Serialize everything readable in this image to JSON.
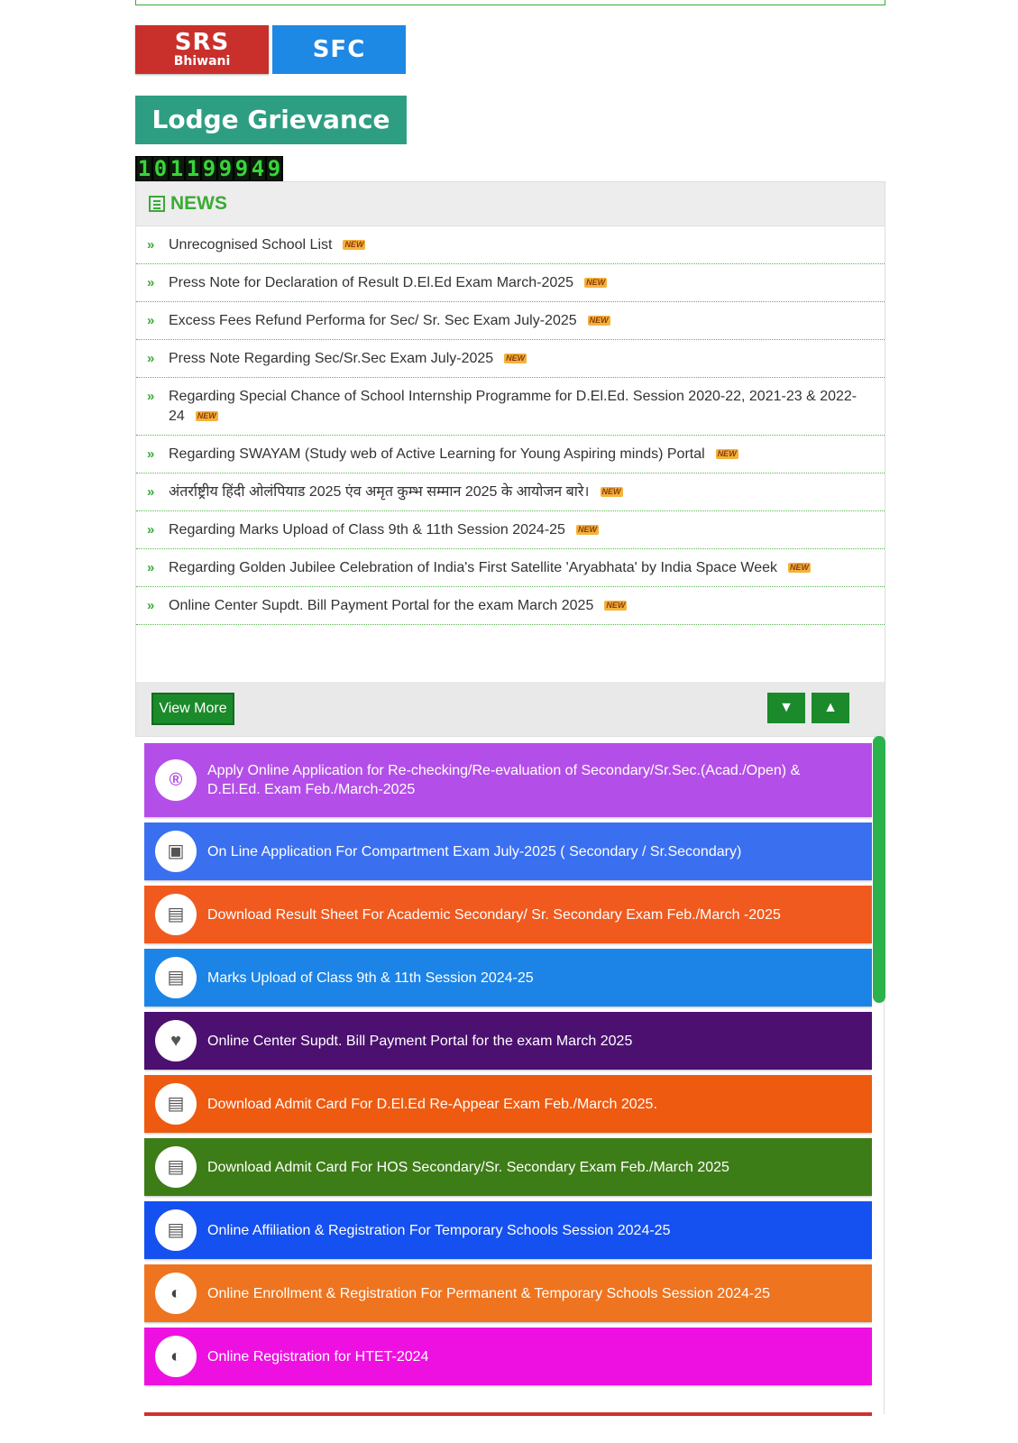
{
  "header": {
    "srs_line1": "SRS",
    "srs_line2": "Bhiwani",
    "sfc_label": "SFC",
    "lodge_label": "Lodge Grievance",
    "counter_digits": [
      "1",
      "0",
      "1",
      "1",
      "9",
      "9",
      "9",
      "4",
      "9"
    ]
  },
  "news": {
    "title": "NEWS",
    "new_badge": "NEW",
    "items": [
      {
        "text": "Unrecognised School List"
      },
      {
        "text": "Press Note for Declaration of Result D.El.Ed Exam March-2025"
      },
      {
        "text": "Excess Fees Refund Performa for Sec/ Sr. Sec Exam July-2025"
      },
      {
        "text": "Press Note Regarding Sec/Sr.Sec Exam July-2025"
      },
      {
        "text": "Regarding Special Chance of School Internship Programme for D.El.Ed. Session 2020-22, 2021-23 & 2022-24"
      },
      {
        "text": "Regarding SWAYAM (Study web of Active Learning for Young Aspiring minds) Portal"
      },
      {
        "text": "अंतर्राष्ट्रीय हिंदी ओलंपियाड 2025 एंव अमृत कुम्भ सम्मान 2025 के आयोजन बारे।"
      },
      {
        "text": "Regarding Marks Upload of Class 9th & 11th Session 2024-25"
      },
      {
        "text": "Regarding Golden Jubilee Celebration of India's First Satellite 'Aryabhata' by India Space Week"
      },
      {
        "text": "Online Center Supdt. Bill Payment Portal for the exam March 2025"
      }
    ],
    "view_more": "View More"
  },
  "services": [
    {
      "label": "Apply Online Application for Re-checking/Re-evaluation of Secondary/Sr.Sec.(Acad./Open) & D.El.Ed. Exam Feb./March-2025",
      "color": "#b44ee8",
      "icon": "registered-icon",
      "glyph": "®",
      "iconColor": "#b44ee8"
    },
    {
      "label": "On Line Application For Compartment Exam July-2025 ( Secondary / Sr.Secondary)",
      "color": "#3a6ff0",
      "icon": "contact-book-icon",
      "glyph": "▣",
      "iconColor": "#555"
    },
    {
      "label": "Download Result Sheet For Academic Secondary/ Sr. Secondary Exam Feb./March -2025",
      "color": "#f05a1e",
      "icon": "id-card-icon",
      "glyph": "▤",
      "iconColor": "#555"
    },
    {
      "label": "Marks Upload of Class 9th & 11th Session 2024-25",
      "color": "#1c84e6",
      "icon": "id-card-icon",
      "glyph": "▤",
      "iconColor": "#555"
    },
    {
      "label": "Online Center Supdt. Bill Payment Portal for the exam March 2025",
      "color": "#4b1070",
      "icon": "heart-circle-icon",
      "glyph": "♥",
      "iconColor": "#555"
    },
    {
      "label": "Download Admit Card For D.El.Ed Re-Appear Exam Feb./March 2025.",
      "color": "#ee5a10",
      "icon": "id-card-outline-icon",
      "glyph": "▤",
      "iconColor": "#555"
    },
    {
      "label": "Download Admit Card For HOS Secondary/Sr. Secondary Exam Feb./March 2025",
      "color": "#3d7d17",
      "icon": "id-card-icon",
      "glyph": "▤",
      "iconColor": "#555"
    },
    {
      "label": "Online Affiliation & Registration For Temporary Schools Session 2024-25",
      "color": "#1550f0",
      "icon": "id-card-outline-icon",
      "glyph": "▤",
      "iconColor": "#555"
    },
    {
      "label": "Online Enrollment & Registration For Permanent & Temporary Schools Session 2024-25",
      "color": "#ee7420",
      "icon": "half-circle-icon",
      "glyph": "◐",
      "iconColor": "#444"
    },
    {
      "label": "Online Registration for HTET-2024",
      "color": "#ee10e0",
      "icon": "half-circle-icon",
      "glyph": "◐",
      "iconColor": "#444"
    }
  ]
}
